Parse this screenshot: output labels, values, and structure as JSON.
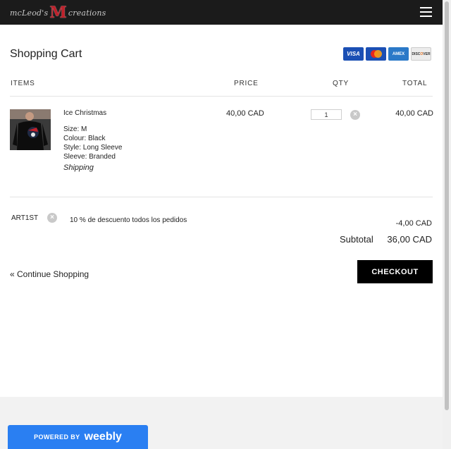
{
  "header": {
    "logo_left": "mcLeod's",
    "logo_mark": "M",
    "logo_right": "creations",
    "menu_icon": "hamburger-menu-icon"
  },
  "cart": {
    "title": "Shopping Cart",
    "payment_cards": [
      "VISA",
      "MASTERCARD",
      "AMEX",
      "DISCOVER"
    ],
    "columns": {
      "items": "ITEMS",
      "price": "PRICE",
      "qty": "QTY",
      "total": "TOTAL"
    },
    "item": {
      "name": "Ice Christmas",
      "options": [
        "Size: M",
        "Colour: Black",
        "Style: Long Sleeve",
        "Sleeve: Branded"
      ],
      "shipping": "Shipping",
      "price": "40,00 CAD",
      "qty": "1",
      "total": "40,00 CAD",
      "remove_icon": "remove-x-icon"
    },
    "discount": {
      "code": "ART1ST",
      "description": "10 % de descuento todos los pedidos",
      "amount": "-4,00 CAD"
    },
    "subtotal_label": "Subtotal",
    "subtotal_value": "36,00 CAD",
    "continue_label": "« Continue Shopping",
    "checkout_label": "CHECKOUT"
  },
  "footer": {
    "powered_by": "POWERED BY",
    "brand": "weebly"
  },
  "colors": {
    "header_bg": "#1b1b1b",
    "checkout_bg": "#000000",
    "weebly_blue": "#2a7ff2",
    "footer_bg": "#f2f2f2"
  }
}
